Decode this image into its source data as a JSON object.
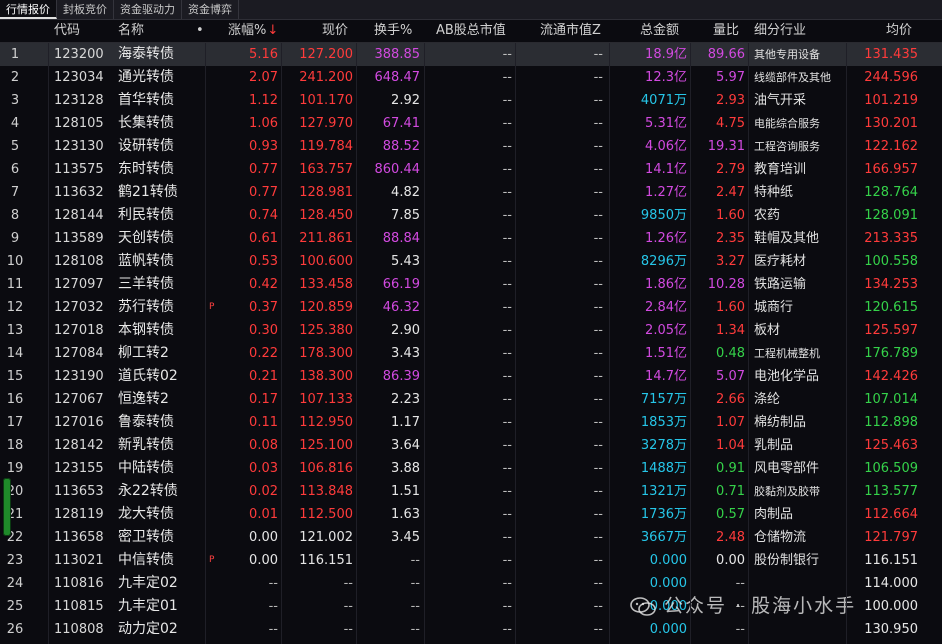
{
  "tabs": [
    "行情报价",
    "封板竞价",
    "资金驱动力",
    "资金博弈"
  ],
  "headers": {
    "code": "代码",
    "name": "名称",
    "dot": "•",
    "chg": "涨幅%",
    "price": "现价",
    "turnover": "换手%",
    "ab_cap": "AB股总市值",
    "float_cap": "流通市值Z",
    "amount": "总金额",
    "ratio": "量比",
    "industry": "细分行业",
    "avg": "均价"
  },
  "colors": {
    "red": "#ff3b3b",
    "green": "#35d24a",
    "magenta": "#d24ae0",
    "cyan": "#26c6e8",
    "white": "#e6e6e6",
    "gray": "#b8b8b8"
  },
  "rows": [
    {
      "idx": "1",
      "code": "123200",
      "name": "海泰转债",
      "flag": "",
      "chg": "5.16",
      "price": "127.200",
      "turnover": "388.85",
      "ab": "--",
      "fc": "--",
      "amount": "18.9亿",
      "ratio": "89.66",
      "industry": "其他专用设备",
      "avg": "131.435"
    },
    {
      "idx": "2",
      "code": "123034",
      "name": "通光转债",
      "flag": "",
      "chg": "2.07",
      "price": "241.200",
      "turnover": "648.47",
      "ab": "--",
      "fc": "--",
      "amount": "12.3亿",
      "ratio": "5.97",
      "industry": "线缆部件及其他",
      "avg": "244.596"
    },
    {
      "idx": "3",
      "code": "123128",
      "name": "首华转债",
      "flag": "",
      "chg": "1.12",
      "price": "101.170",
      "turnover": "2.92",
      "ab": "--",
      "fc": "--",
      "amount": "4071万",
      "ratio": "2.93",
      "industry": "油气开采",
      "avg": "101.219"
    },
    {
      "idx": "4",
      "code": "128105",
      "name": "长集转债",
      "flag": "",
      "chg": "1.06",
      "price": "127.970",
      "turnover": "67.41",
      "ab": "--",
      "fc": "--",
      "amount": "5.31亿",
      "ratio": "4.75",
      "industry": "电能综合服务",
      "avg": "130.201"
    },
    {
      "idx": "5",
      "code": "123130",
      "name": "设研转债",
      "flag": "",
      "chg": "0.93",
      "price": "119.784",
      "turnover": "88.52",
      "ab": "--",
      "fc": "--",
      "amount": "4.06亿",
      "ratio": "19.31",
      "industry": "工程咨询服务",
      "avg": "122.162"
    },
    {
      "idx": "6",
      "code": "113575",
      "name": "东时转债",
      "flag": "",
      "chg": "0.77",
      "price": "163.757",
      "turnover": "860.44",
      "ab": "--",
      "fc": "--",
      "amount": "14.1亿",
      "ratio": "2.79",
      "industry": "教育培训",
      "avg": "166.957"
    },
    {
      "idx": "7",
      "code": "113632",
      "name": "鹤21转债",
      "flag": "",
      "chg": "0.77",
      "price": "128.981",
      "turnover": "4.82",
      "ab": "--",
      "fc": "--",
      "amount": "1.27亿",
      "ratio": "2.47",
      "industry": "特种纸",
      "avg": "128.764"
    },
    {
      "idx": "8",
      "code": "128144",
      "name": "利民转债",
      "flag": "",
      "chg": "0.74",
      "price": "128.450",
      "turnover": "7.85",
      "ab": "--",
      "fc": "--",
      "amount": "9850万",
      "ratio": "1.60",
      "industry": "农药",
      "avg": "128.091"
    },
    {
      "idx": "9",
      "code": "113589",
      "name": "天创转债",
      "flag": "",
      "chg": "0.61",
      "price": "211.861",
      "turnover": "88.84",
      "ab": "--",
      "fc": "--",
      "amount": "1.26亿",
      "ratio": "2.35",
      "industry": "鞋帽及其他",
      "avg": "213.335"
    },
    {
      "idx": "10",
      "code": "128108",
      "name": "蓝帆转债",
      "flag": "",
      "chg": "0.53",
      "price": "100.600",
      "turnover": "5.43",
      "ab": "--",
      "fc": "--",
      "amount": "8296万",
      "ratio": "3.27",
      "industry": "医疗耗材",
      "avg": "100.558"
    },
    {
      "idx": "11",
      "code": "127097",
      "name": "三羊转债",
      "flag": "",
      "chg": "0.42",
      "price": "133.458",
      "turnover": "66.19",
      "ab": "--",
      "fc": "--",
      "amount": "1.86亿",
      "ratio": "10.28",
      "industry": "铁路运输",
      "avg": "134.253"
    },
    {
      "idx": "12",
      "code": "127032",
      "name": "苏行转债",
      "flag": "P",
      "chg": "0.37",
      "price": "120.859",
      "turnover": "46.32",
      "ab": "--",
      "fc": "--",
      "amount": "2.84亿",
      "ratio": "1.60",
      "industry": "城商行",
      "avg": "120.615"
    },
    {
      "idx": "13",
      "code": "127018",
      "name": "本钢转债",
      "flag": "",
      "chg": "0.30",
      "price": "125.380",
      "turnover": "2.90",
      "ab": "--",
      "fc": "--",
      "amount": "2.05亿",
      "ratio": "1.34",
      "industry": "板材",
      "avg": "125.597"
    },
    {
      "idx": "14",
      "code": "127084",
      "name": "柳工转2",
      "flag": "",
      "chg": "0.22",
      "price": "178.300",
      "turnover": "3.43",
      "ab": "--",
      "fc": "--",
      "amount": "1.51亿",
      "ratio": "0.48",
      "industry": "工程机械整机",
      "avg": "176.789"
    },
    {
      "idx": "15",
      "code": "123190",
      "name": "道氏转02",
      "flag": "",
      "chg": "0.21",
      "price": "138.300",
      "turnover": "86.39",
      "ab": "--",
      "fc": "--",
      "amount": "14.7亿",
      "ratio": "5.07",
      "industry": "电池化学品",
      "avg": "142.426"
    },
    {
      "idx": "16",
      "code": "127067",
      "name": "恒逸转2",
      "flag": "",
      "chg": "0.17",
      "price": "107.133",
      "turnover": "2.23",
      "ab": "--",
      "fc": "--",
      "amount": "7157万",
      "ratio": "2.66",
      "industry": "涤纶",
      "avg": "107.014"
    },
    {
      "idx": "17",
      "code": "127016",
      "name": "鲁泰转债",
      "flag": "",
      "chg": "0.11",
      "price": "112.950",
      "turnover": "1.17",
      "ab": "--",
      "fc": "--",
      "amount": "1853万",
      "ratio": "1.07",
      "industry": "棉纺制品",
      "avg": "112.898"
    },
    {
      "idx": "18",
      "code": "128142",
      "name": "新乳转债",
      "flag": "",
      "chg": "0.08",
      "price": "125.100",
      "turnover": "3.64",
      "ab": "--",
      "fc": "--",
      "amount": "3278万",
      "ratio": "1.04",
      "industry": "乳制品",
      "avg": "125.463"
    },
    {
      "idx": "19",
      "code": "123155",
      "name": "中陆转债",
      "flag": "",
      "chg": "0.03",
      "price": "106.816",
      "turnover": "3.88",
      "ab": "--",
      "fc": "--",
      "amount": "1488万",
      "ratio": "0.91",
      "industry": "风电零部件",
      "avg": "106.509"
    },
    {
      "idx": "20",
      "code": "113653",
      "name": "永22转债",
      "flag": "",
      "chg": "0.02",
      "price": "113.848",
      "turnover": "1.51",
      "ab": "--",
      "fc": "--",
      "amount": "1321万",
      "ratio": "0.71",
      "industry": "胶黏剂及胶带",
      "avg": "113.577"
    },
    {
      "idx": "21",
      "code": "128119",
      "name": "龙大转债",
      "flag": "",
      "chg": "0.01",
      "price": "112.500",
      "turnover": "1.63",
      "ab": "--",
      "fc": "--",
      "amount": "1736万",
      "ratio": "0.57",
      "industry": "肉制品",
      "avg": "112.664"
    },
    {
      "idx": "22",
      "code": "113658",
      "name": "密卫转债",
      "flag": "",
      "chg": "0.00",
      "price": "121.002",
      "turnover": "3.45",
      "ab": "--",
      "fc": "--",
      "amount": "3667万",
      "ratio": "2.48",
      "industry": "仓储物流",
      "avg": "121.797"
    },
    {
      "idx": "23",
      "code": "113021",
      "name": "中信转债",
      "flag": "P",
      "chg": "0.00",
      "price": "116.151",
      "turnover": "--",
      "ab": "--",
      "fc": "--",
      "amount": "0.000",
      "ratio": "0.00",
      "industry": "股份制银行",
      "avg": "116.151"
    },
    {
      "idx": "24",
      "code": "110816",
      "name": "九丰定02",
      "flag": "",
      "chg": "--",
      "price": "--",
      "turnover": "--",
      "ab": "--",
      "fc": "--",
      "amount": "0.000",
      "ratio": "--",
      "industry": "",
      "avg": "114.000"
    },
    {
      "idx": "25",
      "code": "110815",
      "name": "九丰定01",
      "flag": "",
      "chg": "--",
      "price": "--",
      "turnover": "--",
      "ab": "--",
      "fc": "--",
      "amount": "0.000",
      "ratio": "--",
      "industry": "",
      "avg": "100.000"
    },
    {
      "idx": "26",
      "code": "110808",
      "name": "动力定02",
      "flag": "",
      "chg": "--",
      "price": "--",
      "turnover": "--",
      "ab": "--",
      "fc": "--",
      "amount": "0.000",
      "ratio": "--",
      "industry": "",
      "avg": "130.950"
    }
  ],
  "selected_row": 0,
  "watermark": "公众号 · 股海小水手",
  "icons": {
    "sort": "arrow-down-icon",
    "wechat": "wechat-icon"
  }
}
